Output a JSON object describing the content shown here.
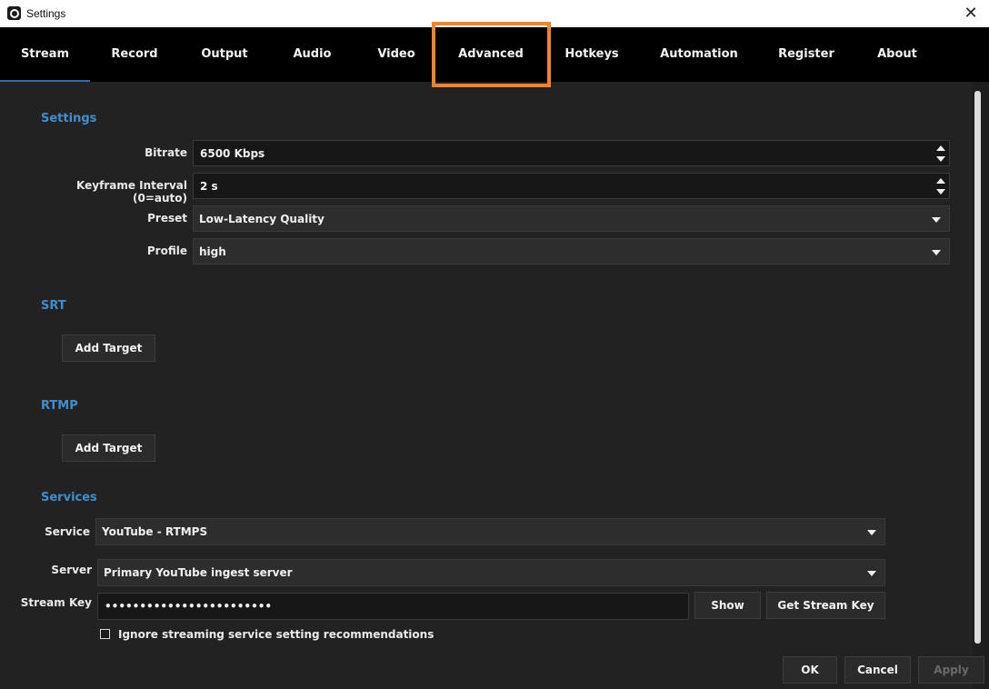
{
  "window": {
    "title": "Settings",
    "close_glyph": "✕"
  },
  "tabs": [
    {
      "label": "Stream",
      "active": true
    },
    {
      "label": "Record"
    },
    {
      "label": "Output"
    },
    {
      "label": "Audio"
    },
    {
      "label": "Video"
    },
    {
      "label": "Advanced",
      "highlighted": true
    },
    {
      "label": "Hotkeys"
    },
    {
      "label": "Automation"
    },
    {
      "label": "Register"
    },
    {
      "label": "About"
    }
  ],
  "highlight_color": "#f48427",
  "accent_color": "#3e8fd0",
  "settings": {
    "heading": "Settings",
    "bitrate": {
      "label": "Bitrate",
      "value": "6500 Kbps"
    },
    "keyframe": {
      "label": "Keyframe Interval (0=auto)",
      "value": "2 s"
    },
    "preset": {
      "label": "Preset",
      "value": "Low-Latency Quality"
    },
    "profile": {
      "label": "Profile",
      "value": "high"
    }
  },
  "srt": {
    "heading": "SRT",
    "add_target": "Add Target"
  },
  "rtmp": {
    "heading": "RTMP",
    "add_target": "Add Target"
  },
  "services": {
    "heading": "Services",
    "service": {
      "label": "Service",
      "value": "YouTube - RTMPS"
    },
    "server": {
      "label": "Server",
      "value": "Primary YouTube ingest server"
    },
    "stream_key": {
      "label": "Stream Key",
      "value": "••••••••••••••••••••••••"
    },
    "show_button": "Show",
    "get_key_button": "Get Stream Key",
    "ignore_checkbox": {
      "label": "Ignore streaming service setting recommendations",
      "checked": false
    }
  },
  "footer": {
    "ok": "OK",
    "cancel": "Cancel",
    "apply": "Apply"
  }
}
